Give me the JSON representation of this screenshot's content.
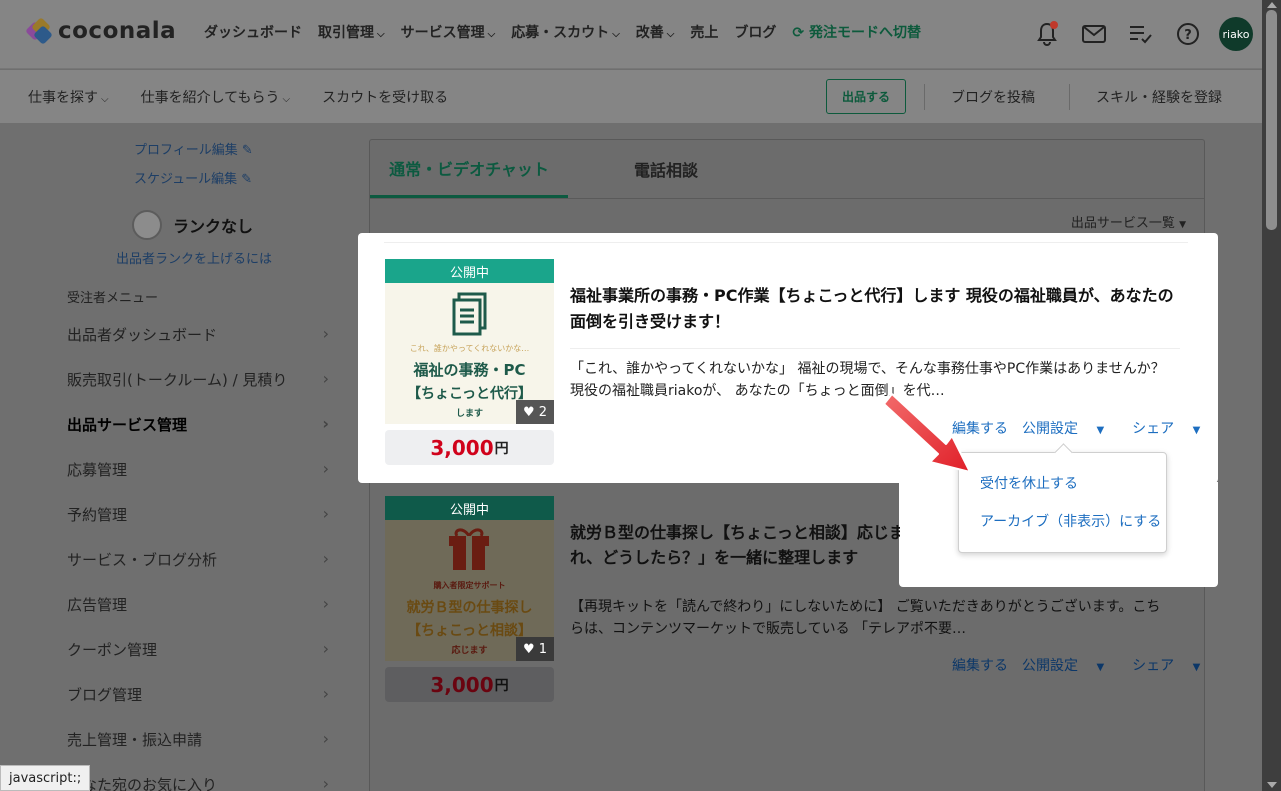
{
  "header": {
    "logo_text": "coconala",
    "nav": [
      {
        "label": "ダッシュボード",
        "chevron": false
      },
      {
        "label": "取引管理",
        "chevron": true
      },
      {
        "label": "サービス管理",
        "chevron": true
      },
      {
        "label": "応募・スカウト",
        "chevron": true
      },
      {
        "label": "改善",
        "chevron": true
      },
      {
        "label": "売上",
        "chevron": false
      },
      {
        "label": "ブログ",
        "chevron": false
      }
    ],
    "switch_mode": "発注モードへ切替",
    "avatar": "riako"
  },
  "subheader": {
    "find_work": "仕事を探す",
    "introduce": "仕事を紹介してもらう",
    "scout": "スカウトを受け取る",
    "listing_button": "出品する",
    "post_blog": "ブログを投稿",
    "register_skills": "スキル・経験を登録"
  },
  "sidebar": {
    "profile_edit": "プロフィール編集",
    "schedule_edit": "スケジュール編集",
    "rank": "ランクなし",
    "rank_link": "出品者ランクを上げるには",
    "menu_heading": "受注者メニュー",
    "menu": [
      {
        "label": "出品者ダッシュボード"
      },
      {
        "label": "販売取引(トークルーム) / 見積り"
      },
      {
        "label": "出品サービス管理",
        "active": true
      },
      {
        "label": "応募管理"
      },
      {
        "label": "予約管理"
      },
      {
        "label": "サービス・ブログ分析"
      },
      {
        "label": "広告管理"
      },
      {
        "label": "クーポン管理"
      },
      {
        "label": "ブログ管理"
      },
      {
        "label": "売上管理・振込申請"
      },
      {
        "label": "あなた宛のお気に入り"
      }
    ]
  },
  "tabs": {
    "active": "通常・ビデオチャット",
    "phone": "電話相談"
  },
  "services_dropdown": "出品サービス一覧",
  "services": [
    {
      "status": "公開中",
      "thumb_small": "これ、誰かやってくれないかな…",
      "thumb_title_1": "福祉の事務・PC",
      "thumb_title_2": "【ちょこっと代行】",
      "thumb_suffix": "します",
      "favorites": "2",
      "price": "3,000",
      "yen": "円",
      "title": "福祉事業所の事務・PC作業【ちょこっと代行】します 現役の福祉職員が、あなたの面倒を引き受けます！",
      "description": "「これ、誰かやってくれないかな」 福祉の現場で、そんな事務仕事やPC作業はありませんか？ 現役の福祉職員riakoが、 あなたの「ちょっと面倒」を代…",
      "actions": {
        "edit": "編集する",
        "publish": "公開設定",
        "share": "シェア"
      }
    },
    {
      "status": "公開中",
      "thumb_small": "購入者限定サポート",
      "thumb_title_1": "就労Ｂ型の仕事探し",
      "thumb_title_2": "【ちょこっと相談】",
      "thumb_suffix": "応じます",
      "favorites": "1",
      "price": "3,000",
      "yen": "円",
      "title_line1": "就労Ｂ型の仕事探し【ちょこっと相談】応じます 再",
      "title_line2": "れ、どうしたら？」を一緒に整理します",
      "description": "【再現キットを「読んで終わり」にしないために】 ご覧いただきありがとうございます。こちらは、コンテンツマーケットで販売している 「テレアポ不要…",
      "actions": {
        "edit": "編集する",
        "publish": "公開設定",
        "share": "シェア"
      }
    }
  ],
  "popup": {
    "pause": "受付を休止する",
    "archive": "アーカイブ（非表示）にする"
  },
  "status_bar": "javascript:;",
  "colors": {
    "brand_green": "#1aa58b",
    "link_blue": "#1d6ec0",
    "price_red": "#d0021b",
    "arrow_red": "#e8302f"
  }
}
